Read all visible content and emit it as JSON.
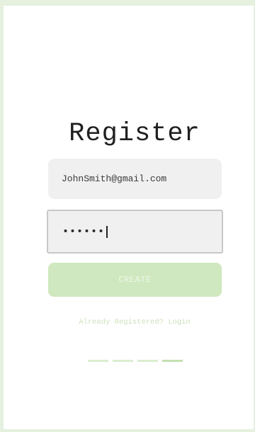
{
  "register": {
    "title": "Register",
    "email_value": "JohnSmith@gmail.com",
    "password_value": "••••••",
    "create_label": "CREATE",
    "login_link": "Already Registered? Login"
  },
  "pager": {
    "count": 4,
    "active_index": 3
  },
  "colors": {
    "accent": "#cfe8bf",
    "background": "#e6f0df"
  }
}
